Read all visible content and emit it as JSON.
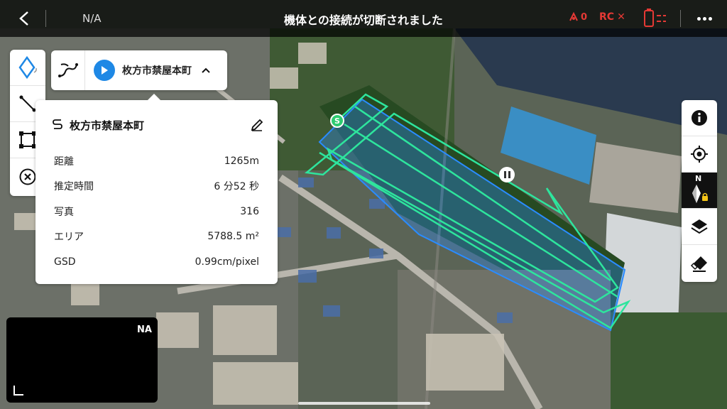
{
  "topbar": {
    "na_label": "N/A",
    "status_title": "機体との接続が切断されました",
    "signal_value": "0",
    "rc_label": "RC",
    "rc_status_mark": "✕",
    "icons": [
      "back-arrow-icon",
      "signal-lost-icon",
      "battery-icon",
      "more-dots-icon"
    ]
  },
  "left_tools": [
    "waypoint-diamond-icon",
    "line-tool-icon",
    "area-tool-icon",
    "clear-cross-icon"
  ],
  "route_card": {
    "name": "枚方市禁屋本町",
    "icons": [
      "route-path-icon",
      "play-icon",
      "chevron-up-icon"
    ]
  },
  "info_panel": {
    "title": "枚方市禁屋本町",
    "rows": [
      {
        "label": "距離",
        "value": "1265m"
      },
      {
        "label": "推定時間",
        "value": "6 分52 秒"
      },
      {
        "label": "写真",
        "value": "316"
      },
      {
        "label": "エリア",
        "value": "5788.5 m²"
      },
      {
        "label": "GSD",
        "value": "0.99cm/pixel"
      }
    ]
  },
  "video_thumb": {
    "label": "NA"
  },
  "right_tools": [
    "info-icon",
    "locate-icon",
    "compass-north-icon",
    "layers-icon",
    "eraser-icon"
  ],
  "compass_label": "N",
  "map_markers": {
    "start_label": "S"
  },
  "colors": {
    "route_green": "#2ee59d",
    "area_blue": "#2a8cff",
    "alert_red": "#e53935",
    "play_blue": "#1e88e5"
  }
}
